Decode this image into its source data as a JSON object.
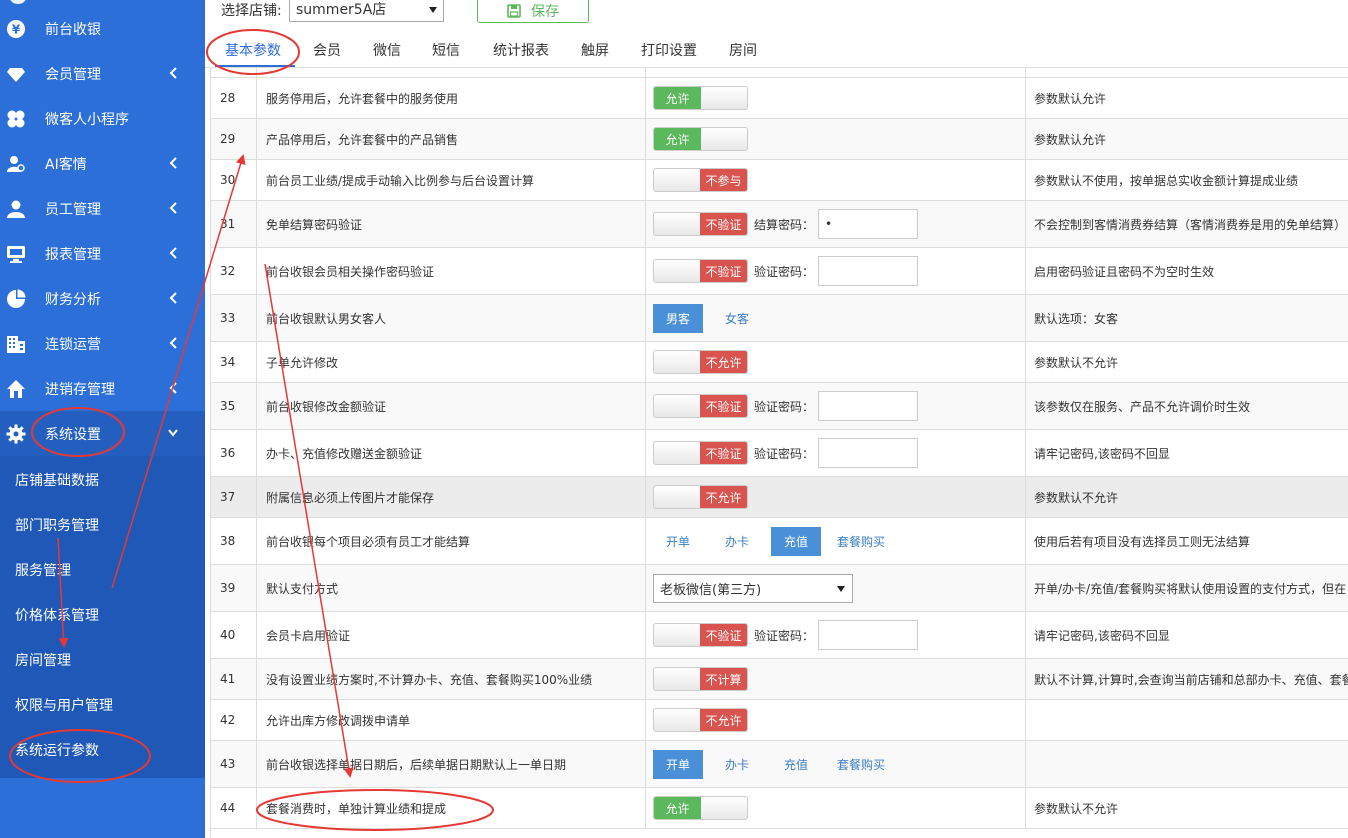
{
  "sidebar": {
    "items": [
      {
        "label": "前台收银",
        "icon": "yen-icon",
        "chevron": false
      },
      {
        "label": "会员管理",
        "icon": "diamond-icon",
        "chevron": true
      },
      {
        "label": "微客人小程序",
        "icon": "clover-icon",
        "chevron": false
      },
      {
        "label": "AI客情",
        "icon": "user-gear-icon",
        "chevron": true
      },
      {
        "label": "员工管理",
        "icon": "user-icon",
        "chevron": true
      },
      {
        "label": "报表管理",
        "icon": "monitor-icon",
        "chevron": true
      },
      {
        "label": "财务分析",
        "icon": "pie-chart-icon",
        "chevron": true
      },
      {
        "label": "连锁运营",
        "icon": "building-icon",
        "chevron": true
      },
      {
        "label": "进销存管理",
        "icon": "home-icon",
        "chevron": true
      },
      {
        "label": "系统设置",
        "icon": "gear-icon",
        "chevron": true
      }
    ],
    "sub_items": [
      "店铺基础数据",
      "部门职务管理",
      "服务管理",
      "价格体系管理",
      "房间管理",
      "权限与用户管理",
      "系统运行参数"
    ]
  },
  "header": {
    "store_label": "选择店铺:",
    "store_value": "summer5A店",
    "save_label": "保存"
  },
  "tabs": [
    "基本参数",
    "会员",
    "微信",
    "短信",
    "统计报表",
    "触屏",
    "打印设置",
    "房间"
  ],
  "rows": [
    {
      "num": "28",
      "label": "服务停用后，允许套餐中的服务使用",
      "type": "toggle",
      "state": "on",
      "text": "允许",
      "desc": "参数默认允许"
    },
    {
      "num": "29",
      "label": "产品停用后，允许套餐中的产品销售",
      "type": "toggle",
      "state": "on",
      "text": "允许",
      "desc": "参数默认允许"
    },
    {
      "num": "30",
      "label": "前台员工业绩/提成手动输入比例参与后台设置计算",
      "type": "toggle",
      "state": "off",
      "text": "不参与",
      "desc": "参数默认不使用，按单据总实收金额计算提成业绩"
    },
    {
      "num": "31",
      "label": "免单结算密码验证",
      "type": "toggle-pwd",
      "state": "off",
      "text": "不验证",
      "pwd_label": "结算密码：",
      "pwd_value": "•",
      "desc": "不会控制到客情消费券结算（客情消费券是用的免单结算）"
    },
    {
      "num": "32",
      "label": "前台收银会员相关操作密码验证",
      "type": "toggle-pwd",
      "state": "off",
      "text": "不验证",
      "pwd_label": "验证密码：",
      "pwd_value": "",
      "desc": "启用密码验证且密码不为空时生效"
    },
    {
      "num": "33",
      "label": "前台收银默认男女客人",
      "type": "options",
      "options": [
        "男客",
        "女客"
      ],
      "selected": 0,
      "desc": "默认选项：女客"
    },
    {
      "num": "34",
      "label": "子单允许修改",
      "type": "toggle",
      "state": "off",
      "text": "不允许",
      "desc": "参数默认不允许"
    },
    {
      "num": "35",
      "label": "前台收银修改金额验证",
      "type": "toggle-pwd",
      "state": "off",
      "text": "不验证",
      "pwd_label": "验证密码：",
      "pwd_value": "",
      "desc": "该参数仅在服务、产品不允许调价时生效"
    },
    {
      "num": "36",
      "label": "办卡、充值修改赠送金额验证",
      "type": "toggle-pwd",
      "state": "off",
      "text": "不验证",
      "pwd_label": "验证密码：",
      "pwd_value": "",
      "desc": "请牢记密码,该密码不回显"
    },
    {
      "num": "37",
      "label": "附属信息必须上传图片才能保存",
      "type": "toggle",
      "state": "off",
      "text": "不允许",
      "desc": "参数默认不允许"
    },
    {
      "num": "38",
      "label": "前台收银每个项目必须有员工才能结算",
      "type": "options",
      "options": [
        "开单",
        "办卡",
        "充值",
        "套餐购买"
      ],
      "selected": 2,
      "desc": "使用后若有项目没有选择员工则无法结算"
    },
    {
      "num": "39",
      "label": "默认支付方式",
      "type": "select",
      "value": "老板微信(第三方)",
      "desc": "开单/办卡/充值/套餐购买将默认使用设置的支付方式，但在"
    },
    {
      "num": "40",
      "label": "会员卡启用验证",
      "type": "toggle-pwd",
      "state": "off",
      "text": "不验证",
      "pwd_label": "验证密码：",
      "pwd_value": "",
      "desc": "请牢记密码,该密码不回显"
    },
    {
      "num": "41",
      "label": "没有设置业绩方案时,不计算办卡、充值、套餐购买100%业绩",
      "type": "toggle",
      "state": "off",
      "text": "不计算",
      "desc": "默认不计算,计算时,会查询当前店铺和总部办卡、充值、套餐"
    },
    {
      "num": "42",
      "label": "允许出库方修改调拨申请单",
      "type": "toggle",
      "state": "off",
      "text": "不允许",
      "desc": ""
    },
    {
      "num": "43",
      "label": "前台收银选择单据日期后，后续单据日期默认上一单日期",
      "type": "options",
      "options": [
        "开单",
        "办卡",
        "充值",
        "套餐购买"
      ],
      "selected": 0,
      "desc": ""
    },
    {
      "num": "44",
      "label": "套餐消费时，单独计算业绩和提成",
      "type": "toggle",
      "state": "on",
      "text": "允许",
      "desc": "参数默认不允许"
    }
  ],
  "colors": {
    "sidebar": "#2d6fd9",
    "accent": "#2d6fd9",
    "on": "#5cb85c",
    "off": "#d9534f",
    "annotation": "#e53935"
  }
}
